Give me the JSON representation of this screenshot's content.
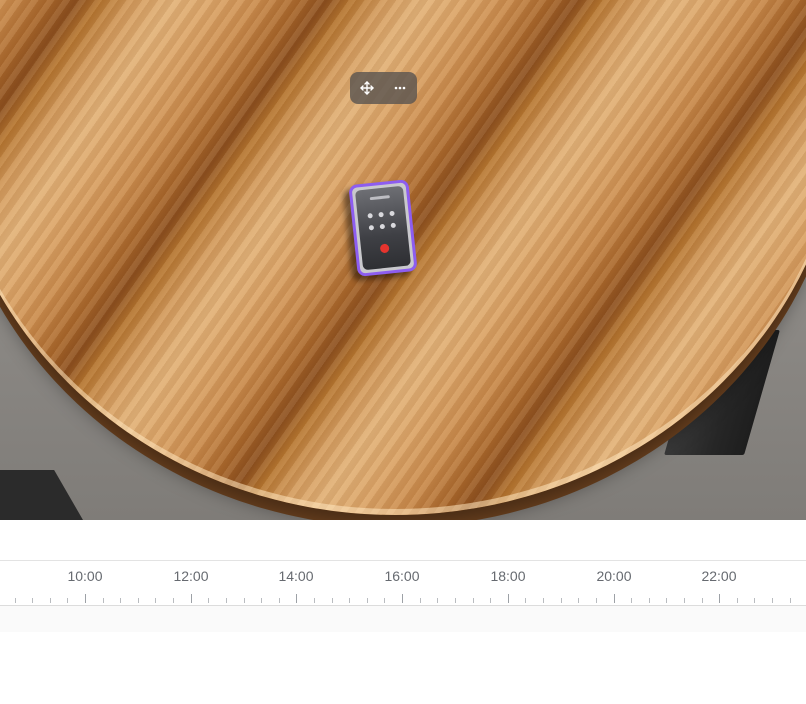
{
  "viewport": {
    "toolbar": {
      "move_icon": "move-arrows-icon",
      "more_icon": "more-dots-icon"
    },
    "selection_color": "#8d5df0",
    "selected_object": "phone"
  },
  "timeline": {
    "labels": [
      "10:00",
      "12:00",
      "14:00",
      "16:00",
      "18:00",
      "20:00",
      "22:00"
    ]
  }
}
